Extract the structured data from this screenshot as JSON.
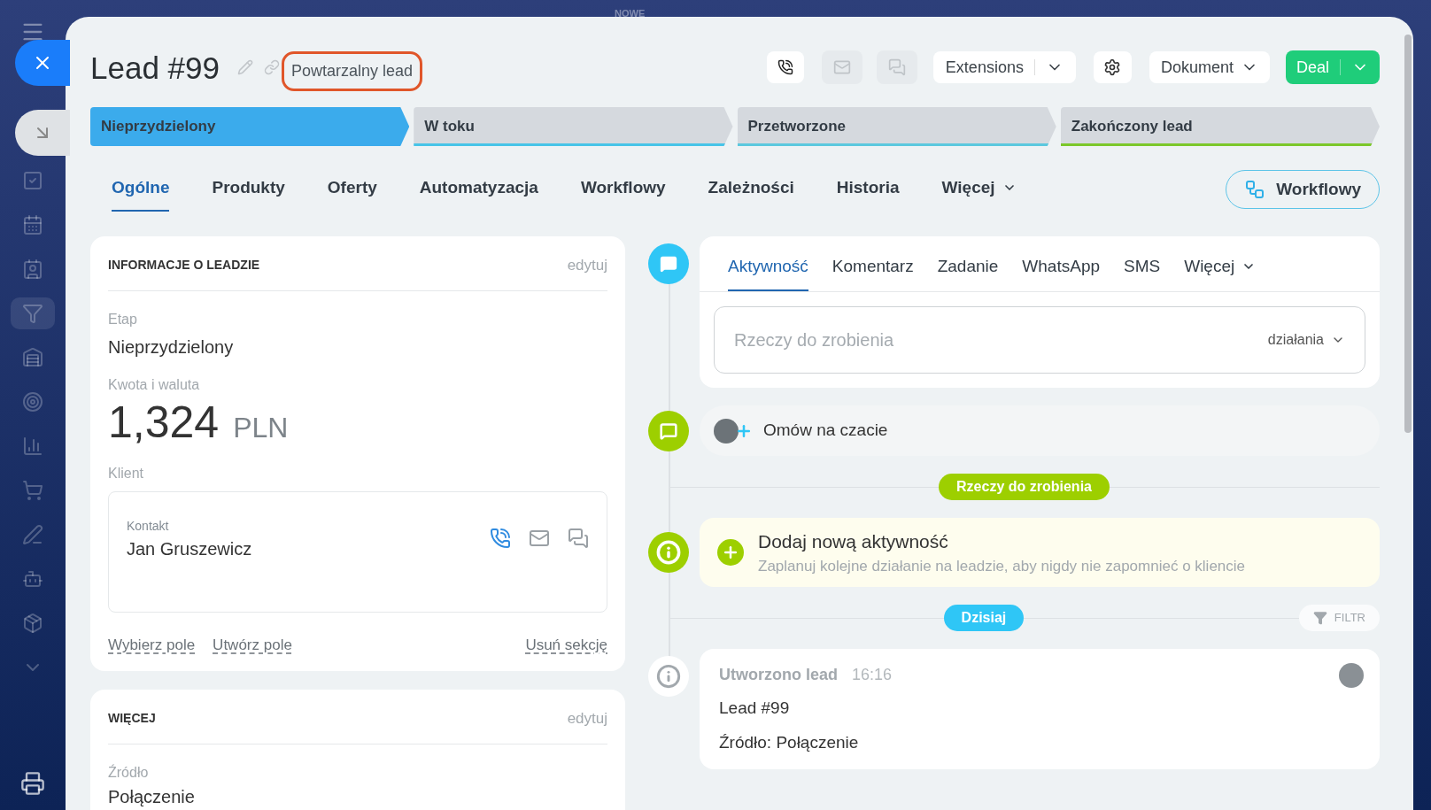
{
  "background": {
    "label": "NOWE"
  },
  "sidebar": {
    "items": [
      {
        "selected": false
      },
      {
        "selected": false
      },
      {
        "selected": false
      },
      {
        "selected": true
      },
      {
        "selected": false
      },
      {
        "selected": false
      },
      {
        "selected": false
      },
      {
        "selected": false
      },
      {
        "selected": false
      },
      {
        "selected": false
      },
      {
        "selected": false
      },
      {
        "selected": false
      }
    ]
  },
  "header": {
    "title": "Lead #99",
    "tag": "Powtarzalny lead",
    "extensions": "Extensions",
    "document": "Dokument",
    "convert": "Deal"
  },
  "stages": [
    {
      "label": "Nieprzydzielony",
      "selected": true
    },
    {
      "label": "W toku",
      "selected": false,
      "color": "#47c4e8"
    },
    {
      "label": "Przetworzone",
      "selected": false,
      "color": "#5bc8de"
    },
    {
      "label": "Zakończony lead",
      "selected": false,
      "color": "#7bc72a"
    }
  ],
  "tabs": [
    {
      "label": "Ogólne",
      "selected": true,
      "kind": "plain"
    },
    {
      "label": "Produkty",
      "selected": false,
      "kind": "plain"
    },
    {
      "label": "Oferty",
      "selected": false,
      "kind": "plain"
    },
    {
      "label": "Automatyzacja",
      "selected": false,
      "kind": "plain"
    },
    {
      "label": "Workflowy",
      "selected": false,
      "kind": "plain"
    },
    {
      "label": "Zależności",
      "selected": false,
      "kind": "plain"
    },
    {
      "label": "Historia",
      "selected": false,
      "kind": "plain"
    },
    {
      "label": "Więcej",
      "selected": false,
      "kind": "dropdown"
    }
  ],
  "workflow_button": "Workflowy",
  "info_card": {
    "title": "INFORMACJE O LEADZIE",
    "edit": "edytuj",
    "stage_label": "Etap",
    "stage_value": "Nieprzydzielony",
    "amount_label": "Kwota i waluta",
    "amount": "1,324",
    "currency": "PLN",
    "client_label": "Klient",
    "contact_label": "Kontakt",
    "contact_name": "Jan Gruszewicz",
    "links": [
      "Wybierz pole",
      "Utwórz pole"
    ],
    "remove": "Usuń sekcję"
  },
  "more_card": {
    "title": "WIĘCEJ",
    "edit": "edytuj",
    "source_label": "Źródło",
    "source_value": "Połączenie"
  },
  "timeline": {
    "composer_tabs": [
      {
        "label": "Aktywność",
        "selected": true,
        "kind": "plain"
      },
      {
        "label": "Komentarz",
        "selected": false,
        "kind": "plain"
      },
      {
        "label": "Zadanie",
        "selected": false,
        "kind": "plain"
      },
      {
        "label": "WhatsApp",
        "selected": false,
        "kind": "plain"
      },
      {
        "label": "SMS",
        "selected": false,
        "kind": "plain"
      },
      {
        "label": "Więcej",
        "selected": false,
        "kind": "dropdown"
      }
    ],
    "placeholder": "Rzeczy do zrobienia",
    "actions": "działania",
    "chat": "Omów na czacie",
    "todo_badge": "Rzeczy do zrobienia",
    "add_title": "Dodaj nową aktywność",
    "add_subtitle": "Zaplanuj kolejne działanie na leadzie, aby nigdy nie zapomnieć o kliencie",
    "today_badge": "Dzisiaj",
    "filter": "FILTR",
    "event": {
      "title": "Utworzono lead",
      "time": "16:16",
      "lines": [
        "Lead #99",
        "Źródło: Połączenie"
      ]
    }
  }
}
